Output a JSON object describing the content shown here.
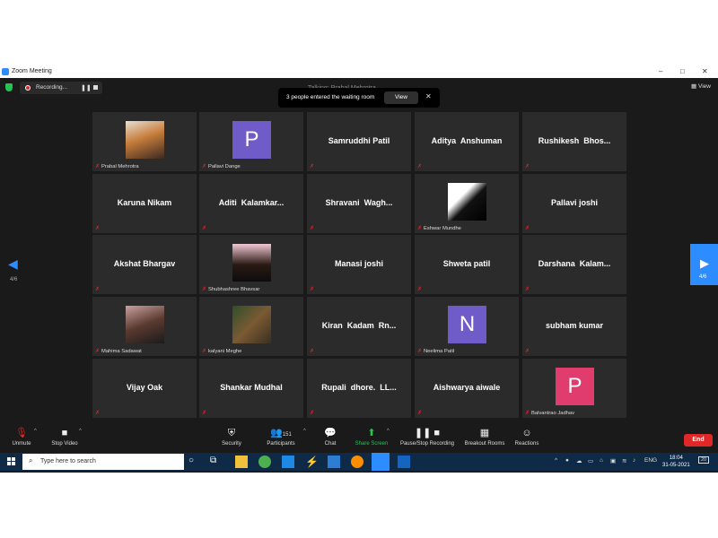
{
  "window": {
    "title": "Zoom Meeting"
  },
  "topbar": {
    "recording_label": "Recording...",
    "speaking_label": "Talking: Prabal Mehrotra",
    "view_label": "View"
  },
  "banner": {
    "message": "3 people entered the waiting room",
    "view_label": "View"
  },
  "pager": {
    "left_page": "4/6",
    "right_page": "4/6"
  },
  "tiles": [
    {
      "type": "photo",
      "label": "Prabal Mehrotra"
    },
    {
      "type": "avatar",
      "letter": "P",
      "color": "#6f5cc9",
      "label": "Pallavi Dange"
    },
    {
      "type": "name",
      "name": "Samruddhi Patil"
    },
    {
      "type": "name",
      "name": "Aditya  Anshuman"
    },
    {
      "type": "name",
      "name": "Rushikesh  Bhos..."
    },
    {
      "type": "name",
      "name": "Karuna Nikam"
    },
    {
      "type": "name",
      "name": "Aditi  Kalamkar..."
    },
    {
      "type": "name",
      "name": "Shravani  Wagh..."
    },
    {
      "type": "photo",
      "label": "Eshwar Mundhe"
    },
    {
      "type": "name",
      "name": "Pallavi joshi"
    },
    {
      "type": "name",
      "name": "Akshat Bhargav"
    },
    {
      "type": "photo",
      "label": "Shubhashree Bhavsar"
    },
    {
      "type": "name",
      "name": "Manasi joshi"
    },
    {
      "type": "name",
      "name": "Shweta patil"
    },
    {
      "type": "name",
      "name": "Darshana  Kalam..."
    },
    {
      "type": "photo",
      "label": "Mahima Sadawat"
    },
    {
      "type": "photo",
      "label": "kalyani Meghe"
    },
    {
      "type": "name",
      "name": "Kiran  Kadam  Rn..."
    },
    {
      "type": "avatar",
      "letter": "N",
      "color": "#6f5cc9",
      "label": "Neelima Patil"
    },
    {
      "type": "name",
      "name": "subham kumar"
    },
    {
      "type": "name",
      "name": "Vijay Oak"
    },
    {
      "type": "name",
      "name": "Shankar Mudhal"
    },
    {
      "type": "name",
      "name": "Rupali  dhore.  LL..."
    },
    {
      "type": "name",
      "name": "Aishwarya aiwale"
    },
    {
      "type": "avatar",
      "letter": "P",
      "color": "#e03c6e",
      "label": "Balvantrao Jadhav"
    }
  ],
  "toolbar": {
    "unmute": "Unmute",
    "stop_video": "Stop Video",
    "security": "Security",
    "participants": "Participants",
    "participants_count": "151",
    "chat": "Chat",
    "share_screen": "Share Screen",
    "recording": "Pause/Stop Recording",
    "breakout": "Breakout Rooms",
    "reactions": "Reactions",
    "end": "End"
  },
  "taskbar": {
    "search_placeholder": "Type here to search",
    "lang": "ENG",
    "time": "18:04",
    "date": "31-05-2021",
    "notifications": "20"
  },
  "colors": {
    "zoom_blue": "#2d8cff",
    "end_red": "#e02828",
    "share_green": "#23c552",
    "tile_bg": "#2b2b2b"
  }
}
